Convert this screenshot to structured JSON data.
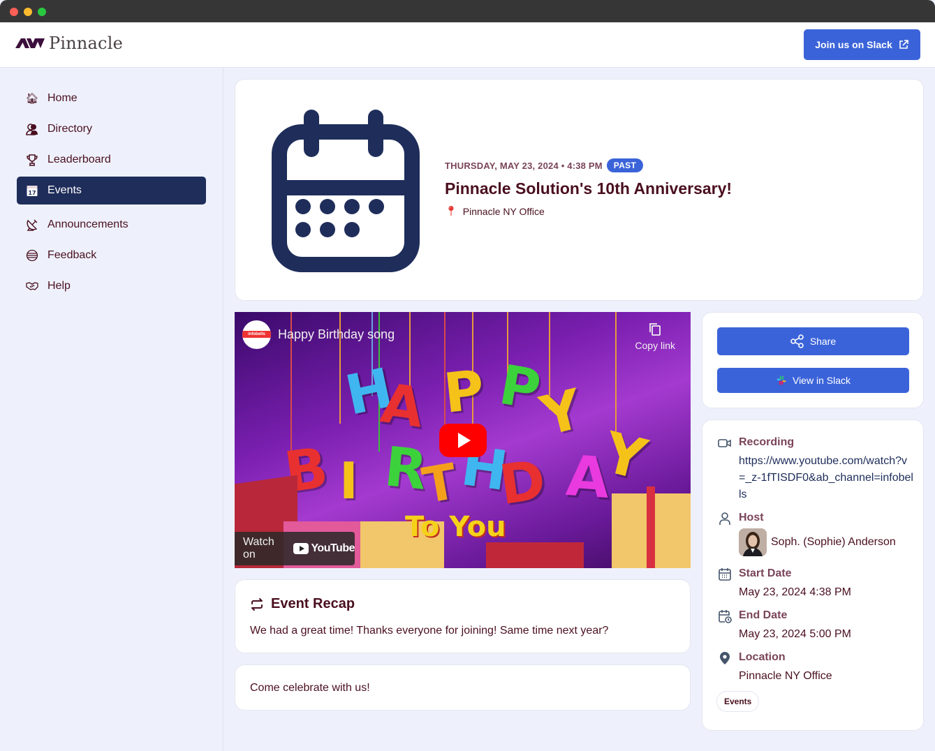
{
  "window": {
    "controls": [
      "close",
      "minimize",
      "zoom"
    ]
  },
  "header": {
    "brand": "Pinnacle",
    "slack_button": "Join us on Slack"
  },
  "sidebar": {
    "items": [
      {
        "label": "Home",
        "icon": "house-icon",
        "active": false
      },
      {
        "label": "Directory",
        "icon": "people-icon",
        "active": false
      },
      {
        "label": "Leaderboard",
        "icon": "trophy-icon",
        "active": false
      },
      {
        "label": "Events",
        "icon": "calendar-icon",
        "active": true
      },
      {
        "label": "Announcements",
        "icon": "satellite-dish-icon",
        "active": false
      },
      {
        "label": "Feedback",
        "icon": "globe-icon",
        "active": false
      },
      {
        "label": "Help",
        "icon": "handshake-icon",
        "active": false
      }
    ]
  },
  "event": {
    "date_line": "THURSDAY, MAY 23, 2024 • 4:38 PM",
    "status_badge": "PAST",
    "title": "Pinnacle Solution's 10th Anniversary!",
    "location": "Pinnacle NY Office"
  },
  "video": {
    "channel": "infobells",
    "title": "Happy Birthday song",
    "copy_link": "Copy link",
    "watch_on": "Watch on",
    "platform": "YouTube",
    "art_letters": [
      "H",
      "A",
      "P",
      "P",
      "Y",
      "B",
      "I",
      "R",
      "T",
      "H",
      "D",
      "A",
      "Y"
    ],
    "art_caption": "To You"
  },
  "recap": {
    "heading": "Event Recap",
    "body": "We had a great time! Thanks everyone for joining! Same time next year?"
  },
  "description": "Come celebrate with us!",
  "actions": {
    "share": "Share",
    "view_slack": "View in Slack"
  },
  "details": {
    "recording_label": "Recording",
    "recording_url": "https://www.youtube.com/watch?v=_z-1fTISDF0&ab_channel=infobells",
    "host_label": "Host",
    "host_name": "Soph. (Sophie) Anderson",
    "start_label": "Start Date",
    "start_value": "May 23, 2024 4:38 PM",
    "end_label": "End Date",
    "end_value": "May 23, 2024 5:00 PM",
    "location_label": "Location",
    "location_value": "Pinnacle NY Office",
    "tag": "Events"
  },
  "colors": {
    "primary": "#3b63d9",
    "nav_active": "#1e2d5a",
    "text": "#4a0f1f",
    "label": "#7a4459",
    "background": "#eef1fc"
  }
}
